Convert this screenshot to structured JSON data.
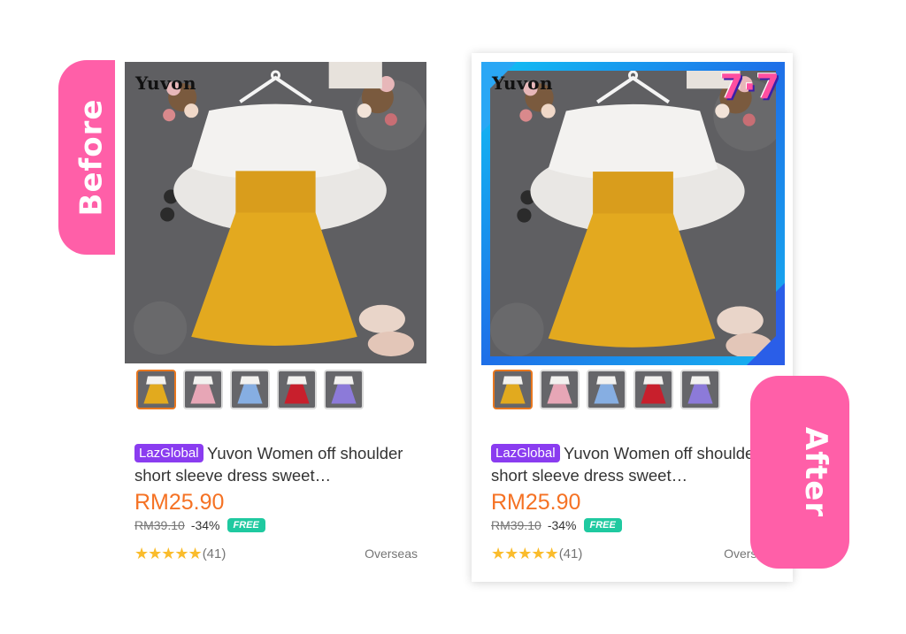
{
  "labels": {
    "before": "Before",
    "after": "After"
  },
  "product": {
    "brand_mark": "Yuvon",
    "badge": "LazGlobal",
    "title": "Yuvon Women off shoulder short sleeve dress sweet…",
    "price": "RM25.90",
    "original_price": "RM39.10",
    "discount": "-34%",
    "shipping_badge": "FREE",
    "stars": "★★★★★",
    "reviews": "(41)",
    "location": "Overseas",
    "rating": 5
  },
  "campaign_badge": "7·7",
  "thumbnails": [
    {
      "color_name": "yellow",
      "skirt": "#e2aa1e"
    },
    {
      "color_name": "pink",
      "skirt": "#e7a6b6"
    },
    {
      "color_name": "blue",
      "skirt": "#86aee2"
    },
    {
      "color_name": "red",
      "skirt": "#c81f2c"
    },
    {
      "color_name": "purple",
      "skirt": "#8c7ad9"
    }
  ],
  "colors": {
    "tab": "#ff5fa8",
    "price": "#f57224",
    "laz": "#8a3cf0",
    "free": "#1fc9a0",
    "star": "#fabc2c",
    "frame": "#1d8ff0"
  }
}
